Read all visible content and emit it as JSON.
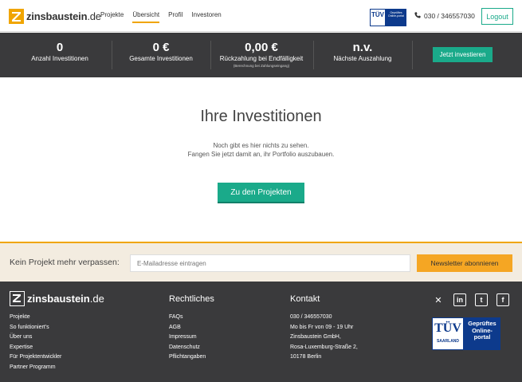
{
  "header": {
    "logo_name": "zinsbaustein",
    "logo_tld": ".de",
    "nav": [
      {
        "label": "Projekte",
        "active": false
      },
      {
        "label": "Übersicht",
        "active": true
      },
      {
        "label": "Profil",
        "active": false
      },
      {
        "label": "Investoren",
        "active": false
      }
    ],
    "tuv_left": "TÜV",
    "tuv_right": "Geprüftes Online-portal",
    "phone": "030 / 346557030",
    "logout": "Logout"
  },
  "stats": {
    "items": [
      {
        "value": "0",
        "label": "Anzahl Investitionen",
        "note": ""
      },
      {
        "value": "0 €",
        "label": "Gesamte Investitionen",
        "note": ""
      },
      {
        "value": "0,00 €",
        "label": "Rückzahlung bei Endfälligkeit",
        "note": "(Berechnung bei Zahlungseingang)"
      },
      {
        "value": "n.v.",
        "label": "Nächste Auszahlung",
        "note": ""
      }
    ],
    "invest_button": "Jetzt investieren"
  },
  "main": {
    "title": "Ihre Investitionen",
    "message_line1": "Noch gibt es hier nichts zu sehen.",
    "message_line2": "Fangen Sie jetzt damit an, ihr Portfolio auszubauen.",
    "projects_button": "Zu den Projekten"
  },
  "newsletter": {
    "label": "Kein Projekt mehr verpassen:",
    "placeholder": "E-Mailadresse eintragen",
    "button": "Newsletter abonnieren"
  },
  "footer": {
    "logo_name": "zinsbaustein",
    "logo_tld": ".de",
    "links": [
      "Projekte",
      "So funktioniert's",
      "Über uns",
      "Expertise",
      "Für Projektentwickler",
      "Partner Programm"
    ],
    "legal_heading": "Rechtliches",
    "legal_links": [
      "FAQs",
      "AGB",
      "Impressum",
      "Datenschutz",
      "Pflichtangaben"
    ],
    "contact_heading": "Kontakt",
    "contact_lines": [
      "030 / 346557030",
      "Mo bis Fr von 09 - 19 Uhr",
      "Zinsbaustein GmbH,",
      "Rosa-Luxemburg-Straße 2,",
      "10178 Berlin"
    ],
    "socials": [
      {
        "icon": "xing-icon",
        "glyph": "✕"
      },
      {
        "icon": "linkedin-icon",
        "glyph": "in"
      },
      {
        "icon": "twitter-icon",
        "glyph": "t"
      },
      {
        "icon": "facebook-icon",
        "glyph": "f"
      }
    ],
    "tuv_big": "TÜV",
    "tuv_region": "SAARLAND",
    "tuv_text": "Geprüftes Online-portal",
    "colors": {
      "accent": "#f0a500",
      "primary": "#1aaa8a",
      "dark": "#3a3a3c"
    }
  }
}
